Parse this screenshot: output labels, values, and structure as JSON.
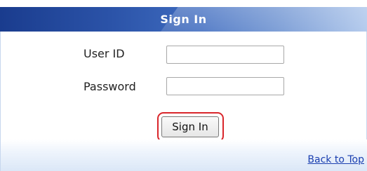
{
  "header": {
    "title": "Sign In"
  },
  "form": {
    "userid_label": "User ID",
    "userid_value": "",
    "password_label": "Password",
    "password_value": "",
    "submit_label": "Sign In"
  },
  "footer": {
    "back_link_label": "Back to Top"
  },
  "colors": {
    "header_dark": "#1a3c8e",
    "header_light": "#a9c3ea",
    "highlight_ring": "#d9262b",
    "link": "#1a3fb0"
  }
}
